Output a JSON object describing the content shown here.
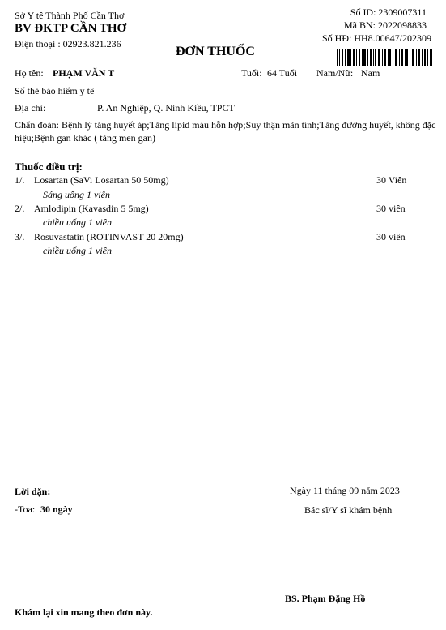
{
  "header": {
    "dept": "Sở Y tê Thành Phố Cần Thơ",
    "hospital": "BV ĐKTP CẦN THƠ",
    "phone": "Điện thoại : 02923.821.236",
    "so_id": "Số ID: 2309007311",
    "ma_bn": "Mã BN: 2022098833",
    "so_hd": "Số HĐ: HH8.00647/202309",
    "title": "ĐƠN THUỐC"
  },
  "patient": {
    "name_label": "Họ tên:",
    "name": "PHẠM VĂN T",
    "age_label": "Tuổi:",
    "age": "64 Tuổi",
    "gender_label": "Nam/Nữ:",
    "gender": "Nam",
    "insurance_label": "Số thẻ bảo hiểm y tê",
    "address_label": "Địa chỉ:",
    "address": "P. An Nghiệp, Q. Ninh Kiều, TPCT",
    "diagnosis_label": "Chẩn đoán:",
    "diagnosis": "Bệnh lý tăng huyết áp;Tăng lipid máu hỗn hợp;Suy thận mãn tính;Tăng đường huyết, không đặc hiệu;Bệnh gan khác ( tăng men gan)"
  },
  "medicines_title": "Thuốc điều trị:",
  "medicines": [
    {
      "index": "1/.",
      "name": "Losartan (SaVi Losartan 50 50mg)",
      "qty": "30 Viên",
      "instruction": "Sáng uống 1 viên"
    },
    {
      "index": "2/.",
      "name": "Amlodipin (Kavasdin 5 5mg)",
      "qty": "30 viên",
      "instruction": "chiều uống 1 viên"
    },
    {
      "index": "3/.",
      "name": "Rosuvastatin (ROTINVAST 20 20mg)",
      "qty": "30 viên",
      "instruction": "chiều uống 1 viên"
    }
  ],
  "footer": {
    "advice_label": "Lời dặn:",
    "toa_label": "-Toa:",
    "toa_value": "30 ngày",
    "date": "Ngày 11 tháng 09 năm 2023",
    "doctor_title": "Bác sĩ/Y sĩ khám bệnh",
    "doctor_name": "BS. Phạm Đặng Hồ",
    "note": "Khám lại xin mang theo đơn này."
  }
}
